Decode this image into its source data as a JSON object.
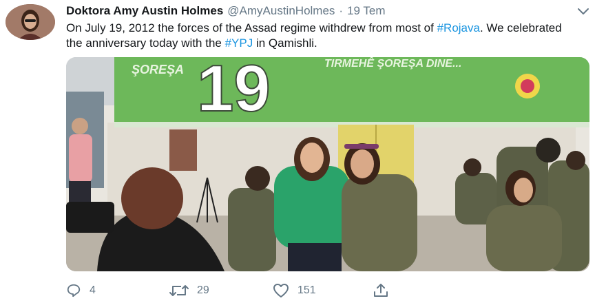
{
  "tweet": {
    "author": {
      "name": "Doktora Amy Austin Holmes",
      "handle": "@AmyAustinHolmes",
      "separator": "·",
      "date": "19 Tem"
    },
    "text": {
      "part1": "On July 19, 2012 the forces of the Assad regime withdrew from most of ",
      "hashtag1": "#Rojava",
      "part2": ". We celebrated the anniversary today with the ",
      "hashtag2": "#YPJ",
      "part3": " in Qamishli."
    },
    "photo": {
      "banner_left": "ŞOREŞA",
      "banner_number": "19",
      "banner_right": "TIRMEHÊ ŞOREŞA DINE..."
    },
    "actions": {
      "replies": "4",
      "retweets": "29",
      "likes": "151"
    },
    "colors": {
      "link": "#1b95e0",
      "muted": "#657786",
      "banner": "#6db85a"
    },
    "icons": [
      "reply-icon",
      "retweet-icon",
      "like-icon",
      "share-icon",
      "chevron-down-icon"
    ]
  }
}
